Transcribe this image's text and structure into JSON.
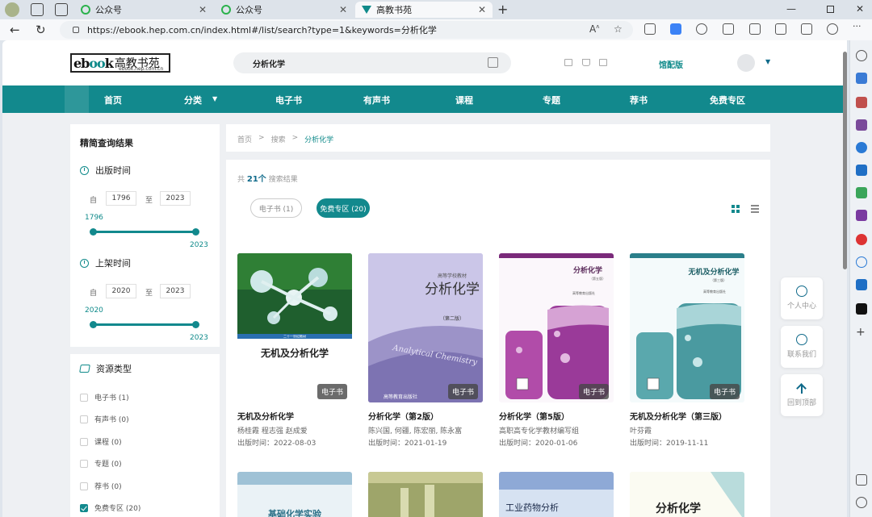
{
  "browser": {
    "tabs": [
      {
        "label": "公众号"
      },
      {
        "label": "公众号"
      },
      {
        "label": "高教书苑"
      }
    ],
    "url": "https://ebook.hep.com.cn/index.html#/list/search?type=1&keywords=分析化学"
  },
  "header": {
    "logo_text": "ebook",
    "logo_cn": "高教书苑",
    "logo_sub": "ebook.hep.com.cn",
    "search_value": "分析化学",
    "institution_label": "馆配版"
  },
  "nav": [
    {
      "label": "首页"
    },
    {
      "label": "分类"
    },
    {
      "label": "电子书"
    },
    {
      "label": "有声书"
    },
    {
      "label": "课程"
    },
    {
      "label": "专题"
    },
    {
      "label": "荐书"
    },
    {
      "label": "免费专区"
    }
  ],
  "filter": {
    "title": "精简查询结果",
    "pub_time": {
      "label": "出版时间",
      "from_label": "自",
      "to_label": "至",
      "from": "1796",
      "to": "2023",
      "min_text": "1796",
      "max_text": "2023"
    },
    "shelf_time": {
      "label": "上架时间",
      "from_label": "自",
      "to_label": "至",
      "from": "2020",
      "to": "2023",
      "min_text": "2020",
      "max_text": "2023"
    },
    "resource_type": {
      "label": "资源类型",
      "options": [
        {
          "label": "电子书 (1)",
          "checked": false
        },
        {
          "label": "有声书 (0)",
          "checked": false
        },
        {
          "label": "课程 (0)",
          "checked": false
        },
        {
          "label": "专题 (0)",
          "checked": false
        },
        {
          "label": "荐书 (0)",
          "checked": false
        },
        {
          "label": "免费专区 (20)",
          "checked": true
        }
      ]
    }
  },
  "breadcrumb": [
    "首页",
    ">",
    "搜索",
    ">",
    "分析化学"
  ],
  "results": {
    "prefix": "共",
    "count": "21个",
    "suffix": "搜索结果",
    "filter_pills": [
      {
        "label": "电子书 (1)",
        "active": false
      },
      {
        "label": "免费专区 (20)",
        "active": true
      }
    ],
    "books": [
      {
        "title": "无机及分析化学",
        "authors": "杨桂霞 程志强 赵成爱",
        "date": "出版时间：2022-08-03",
        "badge": "电子书",
        "cover_title": "无机及分析化学",
        "cover_series": "二十一世纪教材"
      },
      {
        "title": "分析化学（第2版）",
        "authors": "陈兴国, 何疆, 陈宏丽, 陈永富",
        "date": "出版时间：2021-01-19",
        "badge": "电子书",
        "cover_title": "分析化学",
        "cover_sub": "（第二版）",
        "cover_series": "高等学校教材",
        "cover_en": "Analytical Chemistry",
        "cover_publisher": "高等教育出版社"
      },
      {
        "title": "分析化学（第5版）",
        "authors": "高职高专化学教材编写组",
        "date": "出版时间：2020-01-06",
        "badge": "电子书",
        "cover_title": "分析化学",
        "cover_sub": "（第五版）",
        "cover_publisher": "高等教育出版社"
      },
      {
        "title": "无机及分析化学（第三版）",
        "authors": "叶芬霞",
        "date": "出版时间：2019-11-11",
        "badge": "电子书",
        "cover_title": "无机及分析化学",
        "cover_sub": "（第三版）",
        "cover_publisher": "高等教育出版社"
      }
    ],
    "row2_covers": [
      {
        "title": "基础化学实验"
      },
      {
        "title": ""
      },
      {
        "title": "工业药物分析"
      },
      {
        "title": "分析化学"
      }
    ]
  },
  "floating": [
    {
      "label": "个人中心"
    },
    {
      "label": "联系我们"
    },
    {
      "label": "回到顶部"
    }
  ]
}
